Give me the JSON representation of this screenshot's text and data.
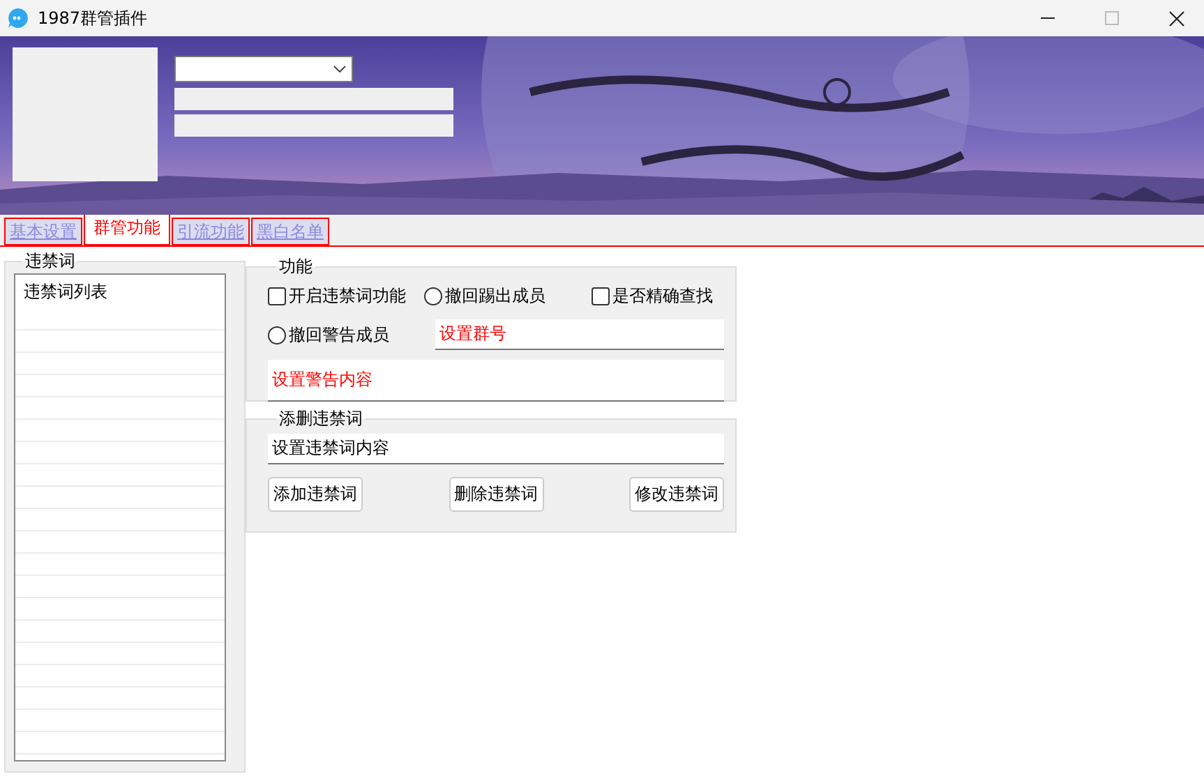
{
  "window": {
    "title": "1987群管插件"
  },
  "tabs": [
    {
      "label": "基本设置",
      "selected": false
    },
    {
      "label": "群管功能",
      "selected": true
    },
    {
      "label": "引流功能",
      "selected": false
    },
    {
      "label": "黑白名单",
      "selected": false
    }
  ],
  "banned_words": {
    "title": "违禁词",
    "list_header": "违禁词列表"
  },
  "functions": {
    "title": "功能",
    "options": [
      {
        "kind": "checkbox",
        "label": "开启违禁词功能",
        "checked": false
      },
      {
        "kind": "radio",
        "label": "撤回踢出成员",
        "selected": false
      },
      {
        "kind": "checkbox",
        "label": "是否精确查找",
        "checked": false
      },
      {
        "kind": "radio",
        "label": "撤回警告成员",
        "selected": false
      }
    ],
    "group_number": {
      "value": "设置群号"
    },
    "warning_content": {
      "value": "设置警告内容"
    }
  },
  "edit": {
    "title": "添删违禁词",
    "word": {
      "value": "设置违禁词内容"
    },
    "buttons": [
      "添加违禁词",
      "删除违禁词",
      "修改违禁词"
    ]
  }
}
